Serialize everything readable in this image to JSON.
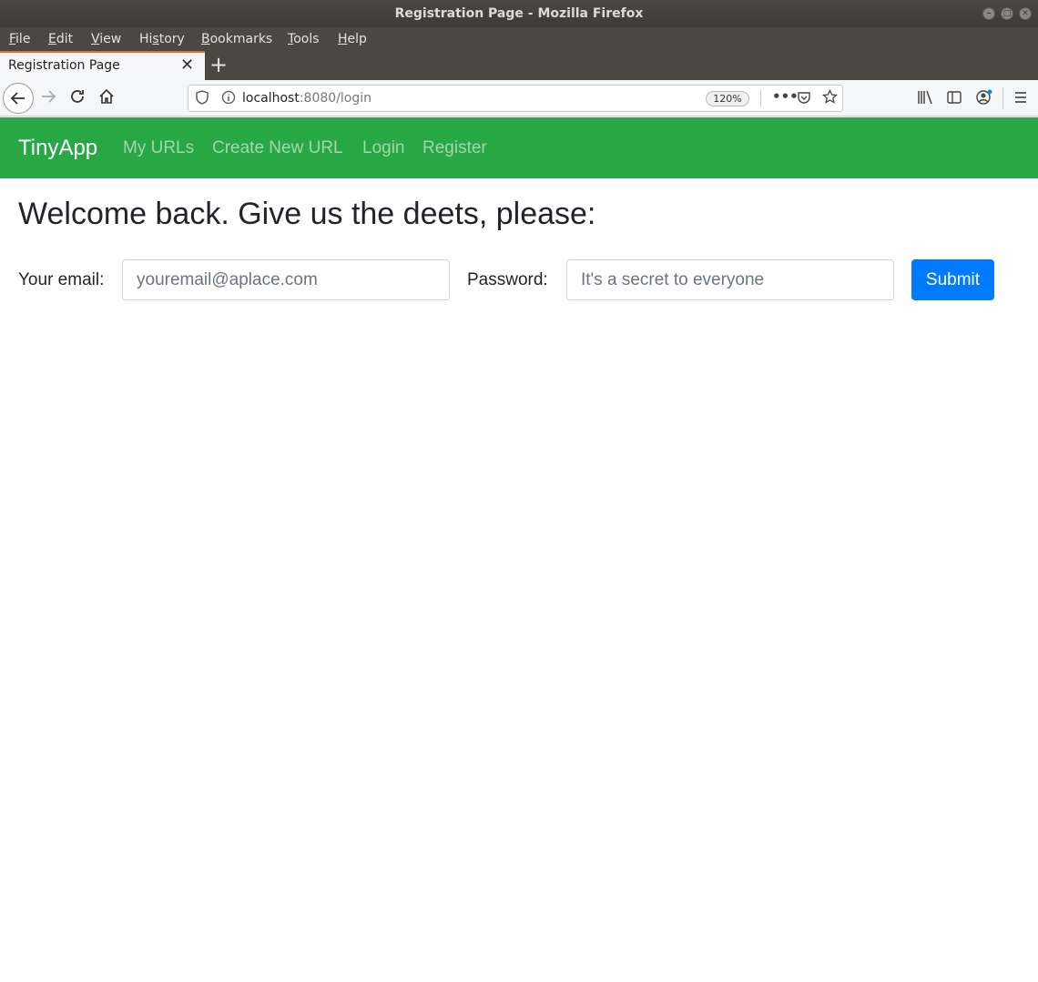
{
  "window": {
    "title": "Registration Page - Mozilla Firefox"
  },
  "menubar": {
    "items": [
      {
        "pre": "",
        "u": "F",
        "post": "ile"
      },
      {
        "pre": "",
        "u": "E",
        "post": "dit"
      },
      {
        "pre": "",
        "u": "V",
        "post": "iew"
      },
      {
        "pre": "Hi",
        "u": "s",
        "post": "tory"
      },
      {
        "pre": "",
        "u": "B",
        "post": "ookmarks"
      },
      {
        "pre": "",
        "u": "T",
        "post": "ools"
      },
      {
        "pre": "",
        "u": "H",
        "post": "elp"
      }
    ]
  },
  "tab": {
    "title": "Registration Page",
    "close": "✕",
    "new_tab": "+"
  },
  "toolbar": {
    "url_host": "localhost",
    "url_rest": ":8080/login",
    "zoom": "120%"
  },
  "site": {
    "brand": "TinyApp",
    "links": [
      "My URLs",
      "Create New URL",
      "Login",
      "Register"
    ],
    "accent": "#28a745"
  },
  "page": {
    "heading": "Welcome back. Give us the deets, please:",
    "email_label": "Your email:",
    "email_placeholder": "youremail@aplace.com",
    "password_label": "Password:",
    "password_placeholder": "It's a secret to everyone",
    "submit_label": "Submit",
    "submit_color": "#007bff"
  }
}
